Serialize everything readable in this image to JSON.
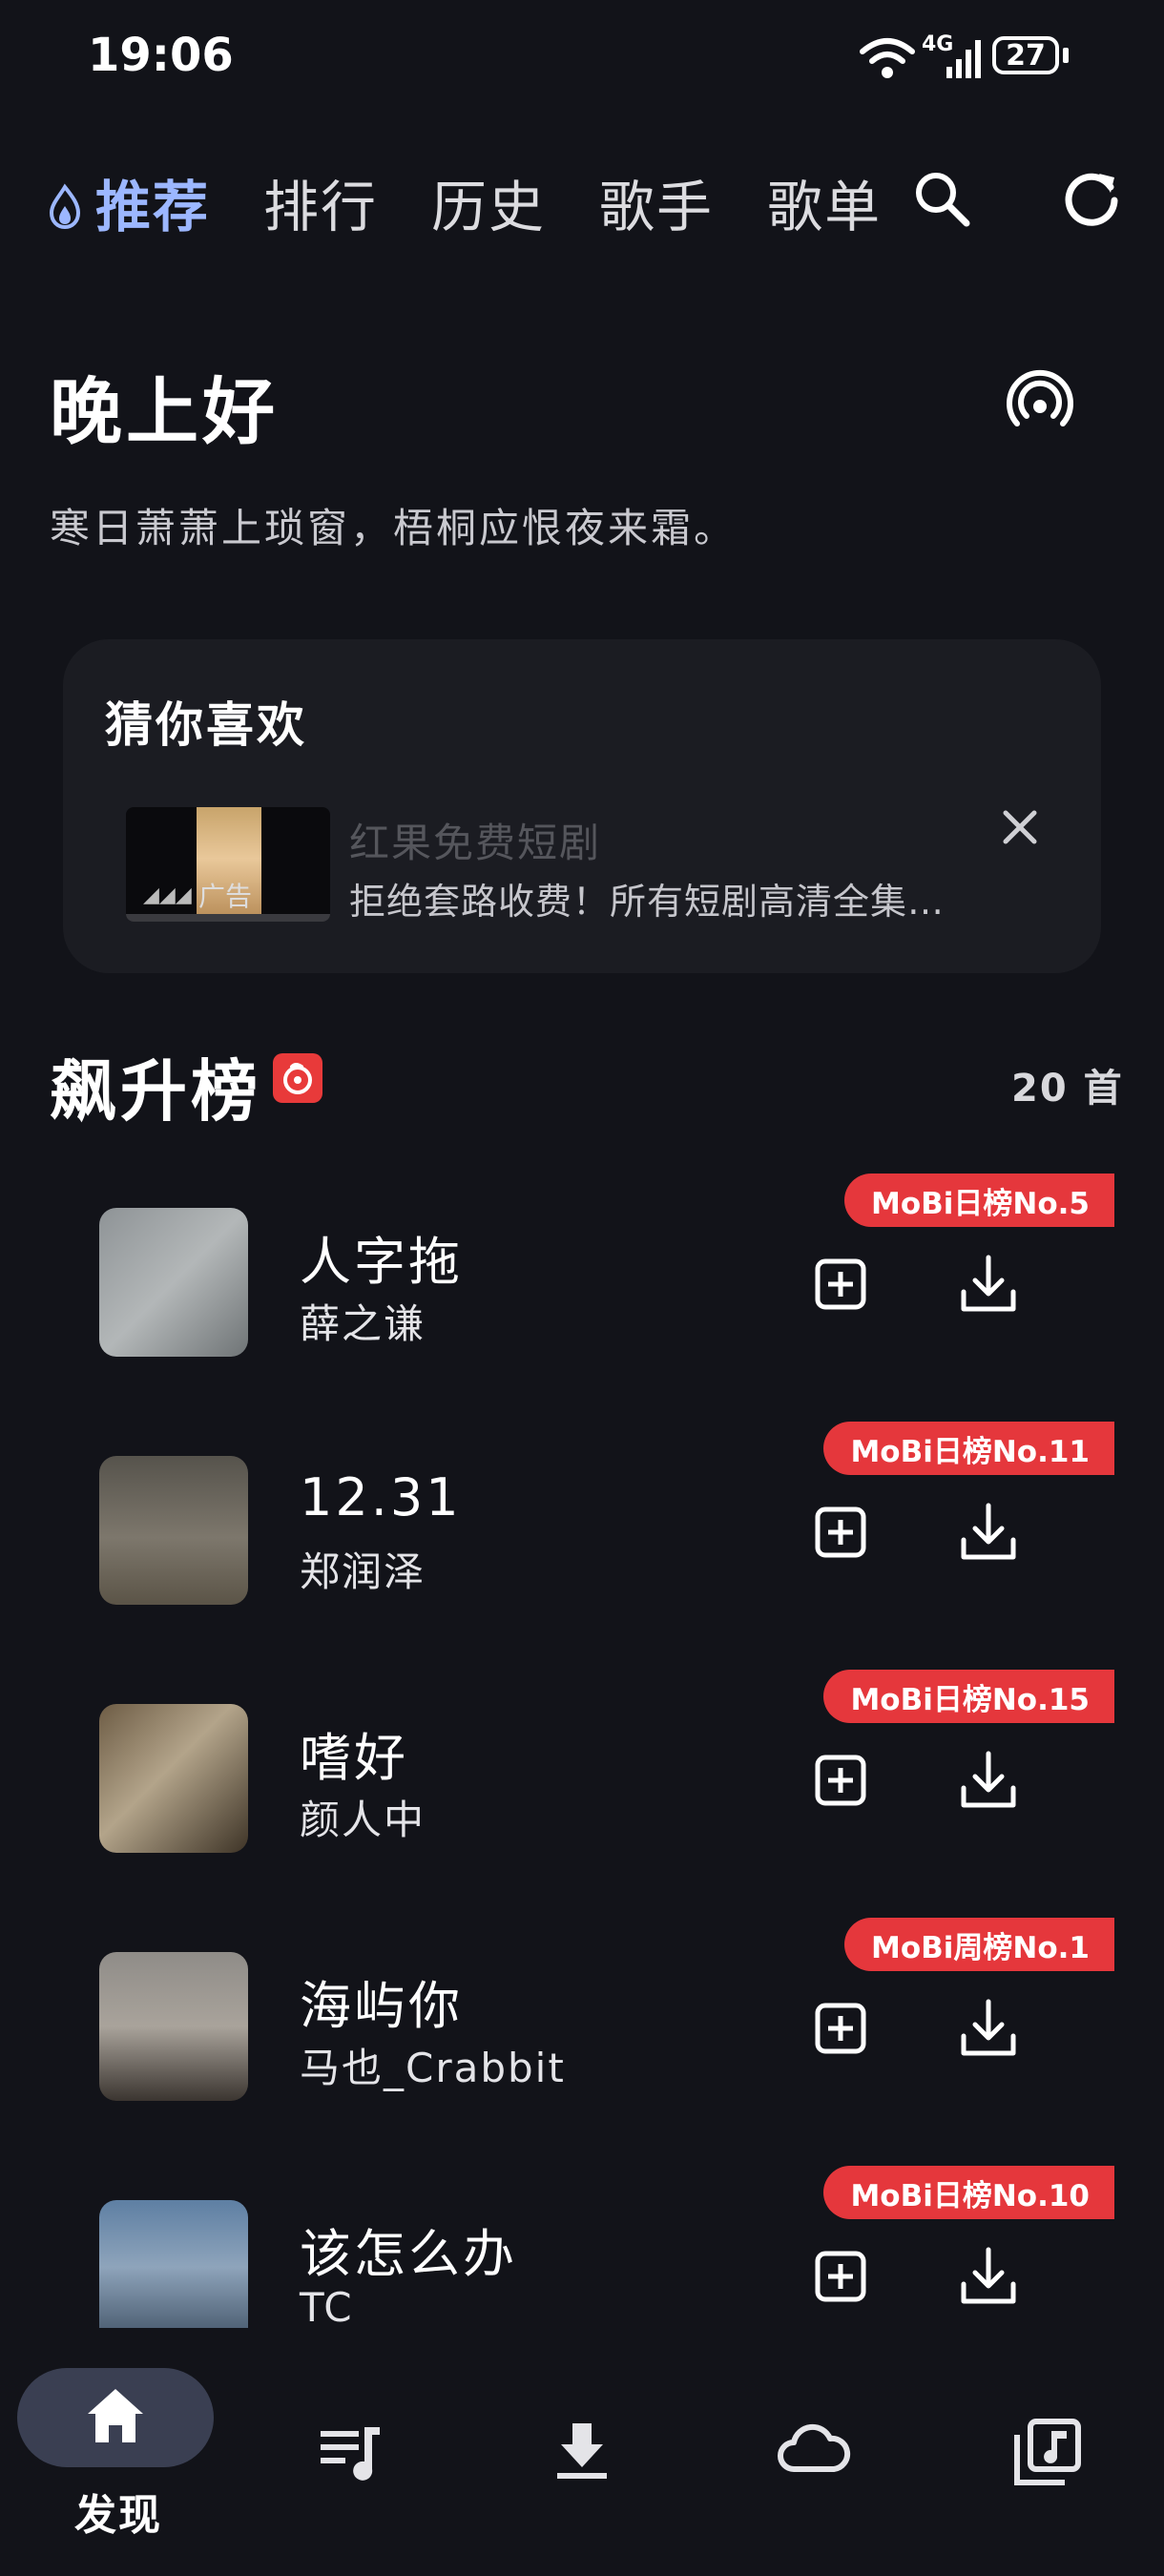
{
  "status_bar": {
    "time": "19:06",
    "network": "4G",
    "battery": "27"
  },
  "top_tabs": [
    {
      "label": "推荐",
      "active": true
    },
    {
      "label": "排行",
      "active": false
    },
    {
      "label": "历史",
      "active": false
    },
    {
      "label": "歌手",
      "active": false
    },
    {
      "label": "歌单",
      "active": false
    }
  ],
  "greeting": {
    "title": "晚上好",
    "poem": "寒日萧萧上琐窗，梧桐应恨夜来霜。"
  },
  "recommend": {
    "title": "猜你喜欢",
    "ad": {
      "title": "红果免费短剧",
      "description": "拒绝套路收费！所有短剧高清全集，...",
      "tag": "广告"
    }
  },
  "chart": {
    "title": "飙升榜",
    "count": "20 首",
    "songs": [
      {
        "title": "人字拖",
        "artist": "薛之谦",
        "badge": "MoBi日榜No.5"
      },
      {
        "title": "12.31",
        "artist": "郑润泽",
        "badge": "MoBi日榜No.11"
      },
      {
        "title": "嗜好",
        "artist": "颜人中",
        "badge": "MoBi日榜No.15"
      },
      {
        "title": "海屿你",
        "artist": "马也_Crabbit",
        "badge": "MoBi周榜No.1"
      },
      {
        "title": "该怎么办",
        "artist": "TC",
        "badge": "MoBi日榜No.10"
      }
    ]
  },
  "bottom_nav": {
    "home_label": "发现"
  },
  "colors": {
    "background": "#121319",
    "accent": "#9cb7ff",
    "badge": "#e5373c",
    "card": "#1b1c22"
  }
}
